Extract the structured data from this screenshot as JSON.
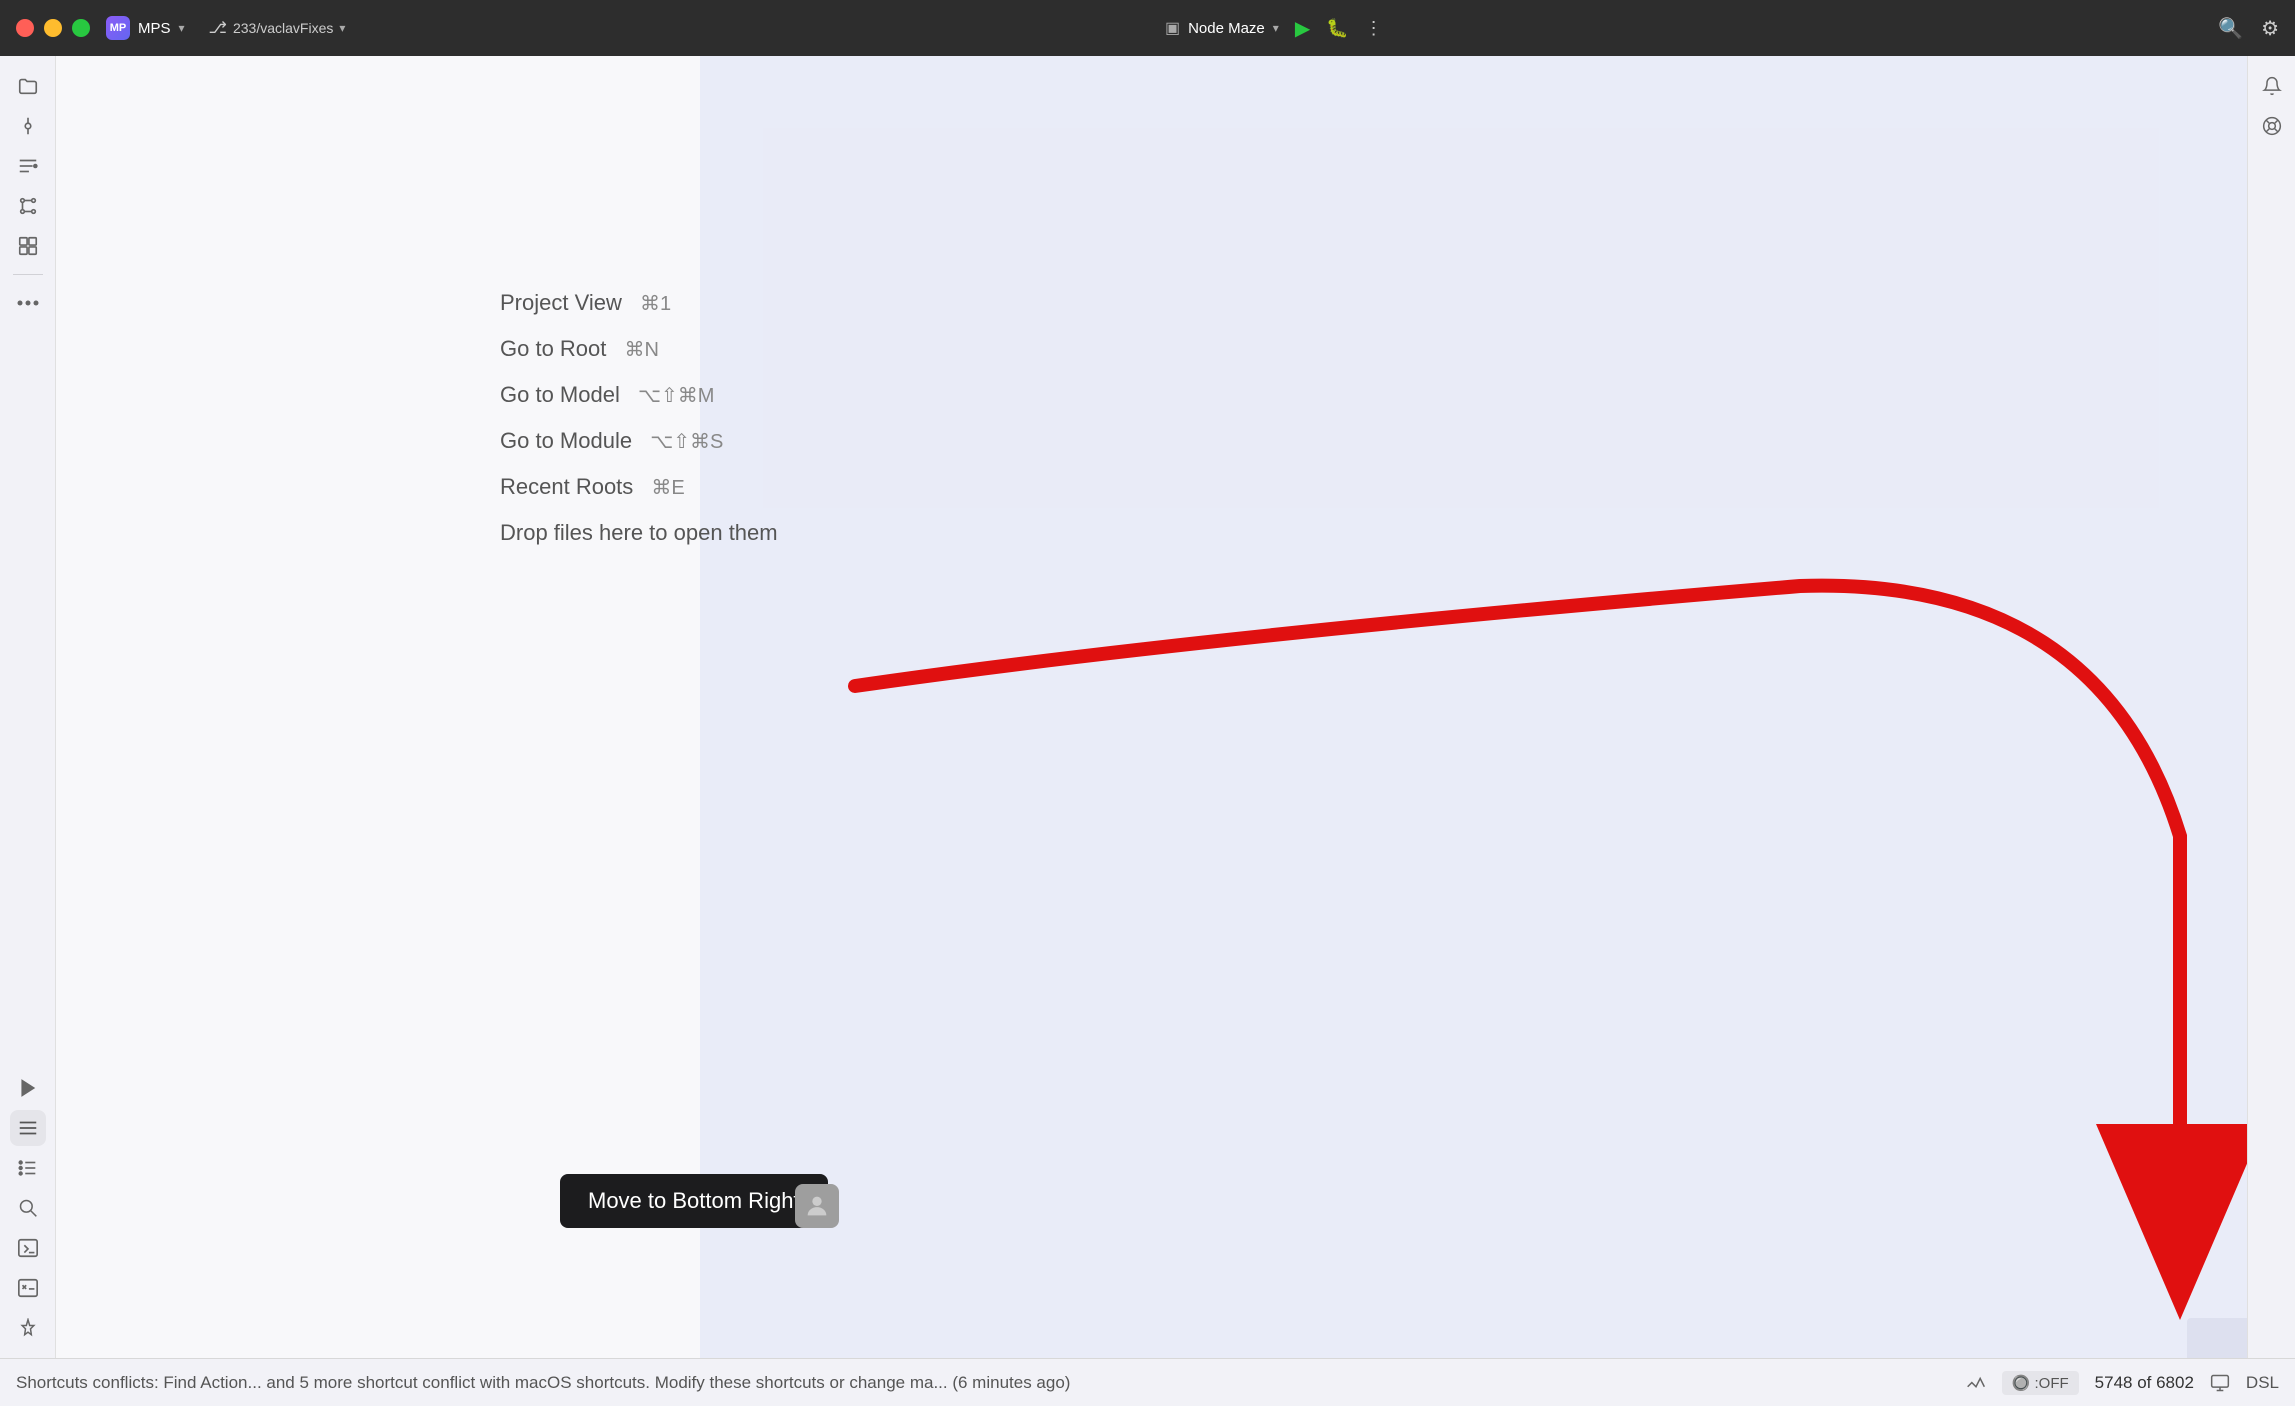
{
  "titlebar": {
    "app_name": "MPS",
    "branch": "233/vaclavFixes",
    "project": "Node Maze",
    "run_icon": "▶",
    "bug_icon": "🐞",
    "more_icon": "⋮",
    "search_icon": "🔍",
    "settings_icon": "⚙"
  },
  "sidebar": {
    "icons": [
      {
        "name": "folder",
        "symbol": "📁",
        "active": false
      },
      {
        "name": "commit",
        "symbol": "◎",
        "active": false
      },
      {
        "name": "filter",
        "symbol": "≡",
        "active": false
      },
      {
        "name": "graph",
        "symbol": "⊕",
        "active": false
      },
      {
        "name": "blocks",
        "symbol": "⊞",
        "active": false
      },
      {
        "name": "more",
        "symbol": "···",
        "active": false
      }
    ],
    "bottom_icons": [
      {
        "name": "run",
        "symbol": "▶"
      },
      {
        "name": "list",
        "symbol": "≡"
      },
      {
        "name": "bullets",
        "symbol": "☰"
      },
      {
        "name": "search",
        "symbol": "🔍"
      },
      {
        "name": "terminal",
        "symbol": ">_"
      },
      {
        "name": "terminal2",
        "symbol": ">_"
      },
      {
        "name": "pin",
        "symbol": "⌖"
      }
    ]
  },
  "menu": {
    "items": [
      {
        "label": "Project View",
        "shortcut": "⌘1"
      },
      {
        "label": "Go to Root",
        "shortcut": "⌘N"
      },
      {
        "label": "Go to Model",
        "shortcut": "⌥⇧⌘M"
      },
      {
        "label": "Go to Module",
        "shortcut": "⌥⇧⌘S"
      },
      {
        "label": "Recent Roots",
        "shortcut": "⌘E"
      },
      {
        "label": "Drop files here to open them",
        "shortcut": ""
      }
    ]
  },
  "tooltip": {
    "move_label": "Move to Bottom Right",
    "avatar_symbol": "👤"
  },
  "statusbar": {
    "conflict_text": "Shortcuts conflicts: Find Action... and 5 more shortcut conflict with macOS shortcuts. Modify these shortcuts or change ma... (6 minutes ago)",
    "badge_text": ":OFF",
    "count_text": "5748 of 6802",
    "dsl_text": "DSL"
  },
  "right_sidebar": {
    "icons": [
      {
        "name": "notification",
        "symbol": "🔔"
      },
      {
        "name": "settings",
        "symbol": "⚙"
      }
    ]
  }
}
